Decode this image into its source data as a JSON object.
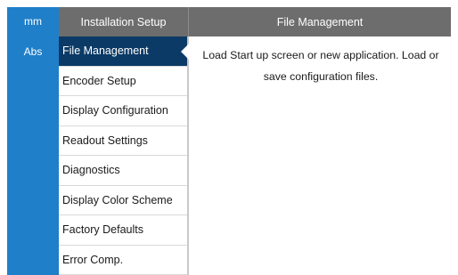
{
  "units": {
    "mm": "mm",
    "abs": "Abs"
  },
  "header": {
    "left_title": "Installation Setup",
    "right_title": "File Management"
  },
  "menu": {
    "items": [
      {
        "label": "File Management"
      },
      {
        "label": "Encoder Setup"
      },
      {
        "label": "Display Configuration"
      },
      {
        "label": "Readout Settings"
      },
      {
        "label": "Diagnostics"
      },
      {
        "label": "Display Color Scheme"
      },
      {
        "label": "Factory Defaults"
      },
      {
        "label": "Error Comp."
      }
    ],
    "active_index": 0
  },
  "content": {
    "description": "Load Start up screen or new application.  Load or save configuration files."
  },
  "colors": {
    "units_strip": "#1f7fc9",
    "header_bg": "#6d6d6d",
    "active_item_bg": "#0b3a66"
  }
}
